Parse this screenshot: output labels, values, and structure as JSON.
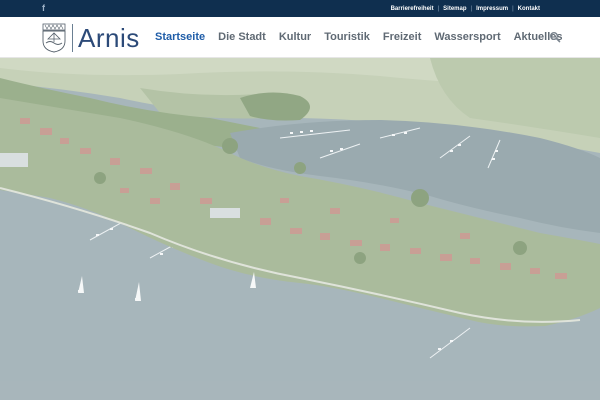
{
  "topbar": {
    "social_icon": "facebook-icon",
    "links": [
      {
        "label": "Barrierefreiheit"
      },
      {
        "label": "Sitemap"
      },
      {
        "label": "Impressum"
      },
      {
        "label": "Kontakt"
      }
    ],
    "separator": "|"
  },
  "header": {
    "logo_icon": "coat-of-arms-icon",
    "logo_text": "Arnis",
    "nav": [
      {
        "label": "Startseite",
        "active": true
      },
      {
        "label": "Die Stadt",
        "active": false
      },
      {
        "label": "Kultur",
        "active": false
      },
      {
        "label": "Touristik",
        "active": false
      },
      {
        "label": "Freizeit",
        "active": false
      },
      {
        "label": "Wassersport",
        "active": false
      },
      {
        "label": "Aktuelles",
        "active": false
      }
    ],
    "search_icon": "search-icon"
  },
  "colors": {
    "topbar_bg": "#0f2f4f",
    "accent": "#1f5da8",
    "logo_text": "#2c4a78",
    "nav_text": "#606a74"
  },
  "hero": {
    "image_name": "aerial-view-of-arnis"
  }
}
